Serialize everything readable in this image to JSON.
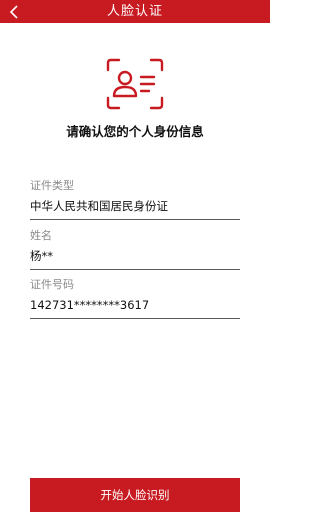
{
  "header": {
    "title": "人脸认证",
    "back_icon": "chevron-left-icon"
  },
  "hero": {
    "icon": "face-id-card-icon",
    "heading": "请确认您的个人身份信息"
  },
  "fields": [
    {
      "label": "证件类型",
      "value": "中华人民共和国居民身份证"
    },
    {
      "label": "姓名",
      "value": "杨**"
    },
    {
      "label": "证件号码",
      "value": "142731********3617"
    }
  ],
  "actions": {
    "start_label": "开始人脸识别"
  },
  "colors": {
    "brand_red": "#c81b21"
  }
}
